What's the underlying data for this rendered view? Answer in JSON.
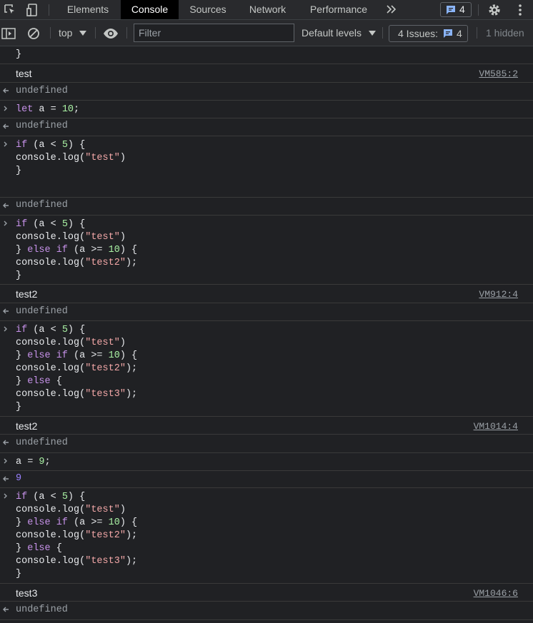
{
  "tabs": [
    {
      "label": "Elements"
    },
    {
      "label": "Console",
      "active": true
    },
    {
      "label": "Sources"
    },
    {
      "label": "Network"
    },
    {
      "label": "Performance"
    }
  ],
  "more_tabs_icon": "chevron-double-right-icon",
  "messages_badge": {
    "count": "4"
  },
  "toolbar": {
    "context": "top",
    "filter_placeholder": "Filter",
    "levels": "Default levels",
    "issues_label": "4 Issues:",
    "issues_count": "4",
    "hidden": "1 hidden"
  },
  "colors": {
    "bg": "#202124",
    "keyword": "#c792ea",
    "number": "#aaf2a4",
    "string": "#f2a7a7",
    "accent": "#8ab4f8"
  },
  "console": {
    "partial_top": "}",
    "log1": {
      "text": "test",
      "source": "VM585:2"
    },
    "result_undefined": "undefined",
    "input_let": "let a = 10;",
    "if_block1": [
      "if (a < 5) {",
      "console.log(\"test\")",
      "}"
    ],
    "if_block2": [
      "if (a < 5) {",
      "console.log(\"test\")",
      "} else if (a >= 10) {",
      "console.log(\"test2\");",
      "}"
    ],
    "log2": {
      "text": "test2",
      "source": "VM912:4"
    },
    "if_block3": [
      "if (a < 5) {",
      "console.log(\"test\")",
      "} else if (a >= 10) {",
      "console.log(\"test2\");",
      "} else {",
      "console.log(\"test3\");",
      "}"
    ],
    "log3": {
      "text": "test2",
      "source": "VM1014:4"
    },
    "input_assign": "a = 9;",
    "result_9": "9",
    "log4": {
      "text": "test3",
      "source": "VM1046:6"
    }
  }
}
